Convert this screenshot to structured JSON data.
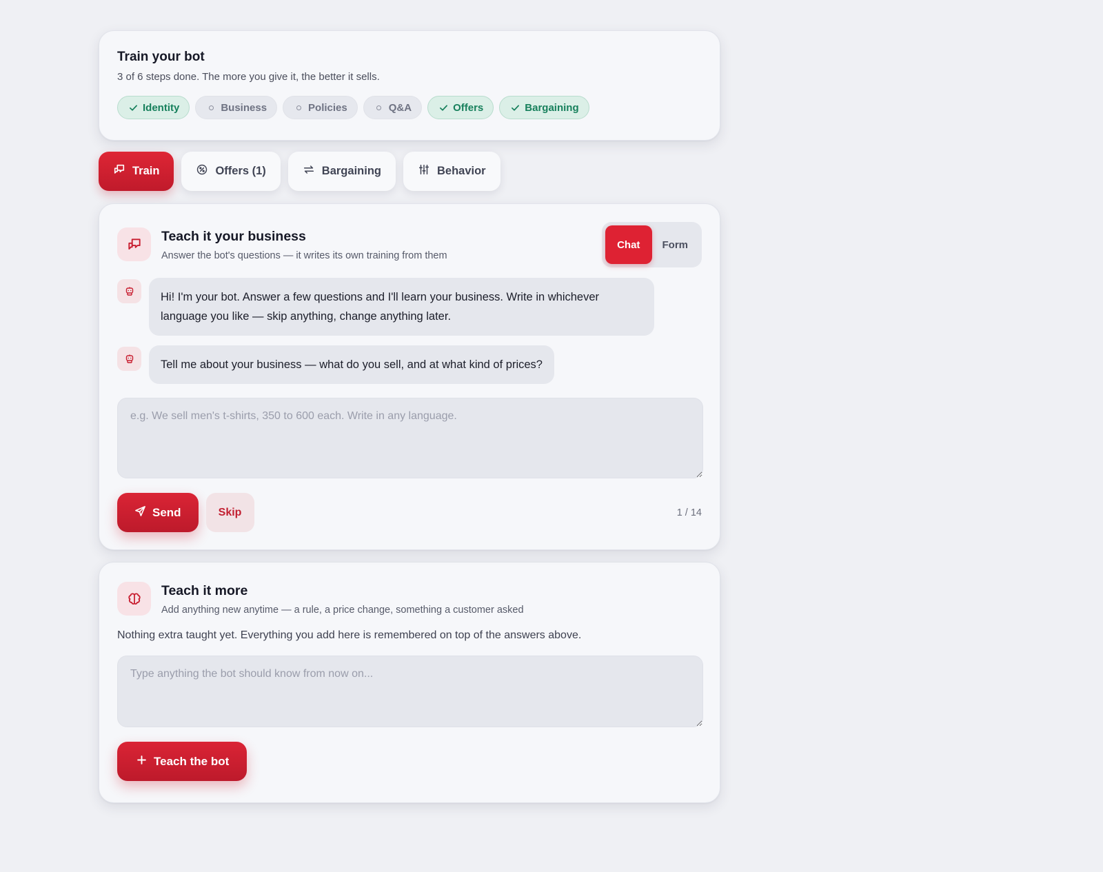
{
  "progress": {
    "title": "Train your bot",
    "subtitle": "3 of 6 steps done. The more you give it, the better it sells.",
    "steps": [
      {
        "label": "Identity",
        "done": true
      },
      {
        "label": "Business",
        "done": false
      },
      {
        "label": "Policies",
        "done": false
      },
      {
        "label": "Q&A",
        "done": false
      },
      {
        "label": "Offers",
        "done": true
      },
      {
        "label": "Bargaining",
        "done": true
      }
    ]
  },
  "tabs": [
    {
      "label": "Train",
      "icon": "chat-bubbles-icon",
      "active": true
    },
    {
      "label": "Offers (1)",
      "icon": "offer-badge-icon",
      "active": false
    },
    {
      "label": "Bargaining",
      "icon": "swap-arrows-icon",
      "active": false
    },
    {
      "label": "Behavior",
      "icon": "sliders-icon",
      "active": false
    }
  ],
  "teach": {
    "title": "Teach it your business",
    "subtitle": "Answer the bot's questions — it writes its own training from them",
    "mode": {
      "chat": "Chat",
      "form": "Form",
      "selected": "Chat"
    },
    "messages": [
      "Hi! I'm your bot. Answer a few questions and I'll learn your business. Write in whichever language you like — skip anything, change anything later.",
      "Tell me about your business — what do you sell, and at what kind of prices?"
    ],
    "answer_placeholder": "e.g. We sell men's t-shirts, 350 to 600 each. Write in any language.",
    "send_label": "Send",
    "skip_label": "Skip",
    "counter": "1 / 14"
  },
  "more": {
    "title": "Teach it more",
    "subtitle": "Add anything new anytime — a rule, a price change, something a customer asked",
    "empty_text": "Nothing extra taught yet. Everything you add here is remembered on top of the answers above.",
    "input_placeholder": "Type anything the bot should know from now on...",
    "button_label": "Teach the bot"
  },
  "colors": {
    "accent": "#de2233",
    "success": "#17805c",
    "background": "#eff0f4"
  }
}
